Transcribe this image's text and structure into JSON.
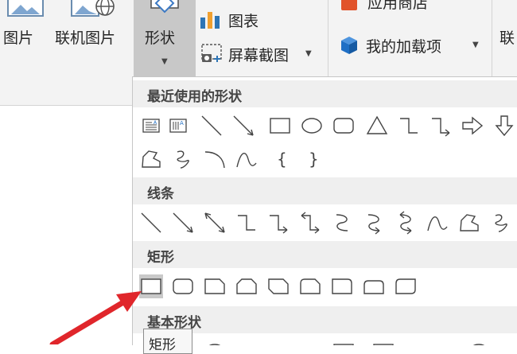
{
  "ribbon": {
    "pictures_label": "图片",
    "online_pictures_label": "联机图片",
    "shapes_label": "形状",
    "chart_label": "图表",
    "screenshot_label": "屏幕截图",
    "store_label": "应用商店",
    "my_addins_label": "我的加载项",
    "partial_label": "联",
    "chart_bar_colors": [
      "#2e75b6",
      "#f0a030",
      "#2e75b6"
    ],
    "store_icon_color": "#e1532b",
    "addins_icon_color": "#1f6fc5"
  },
  "shapes_panel": {
    "sections": [
      {
        "title": "最近使用的形状"
      },
      {
        "title": "线条"
      },
      {
        "title": "矩形"
      },
      {
        "title": "基本形状"
      }
    ],
    "recent_row1": [
      "text-box-icon",
      "vertical-text-box-icon",
      "line-icon",
      "arrow-line-icon",
      "rectangle-icon",
      "oval-icon",
      "rounded-rectangle-icon",
      "triangle-icon",
      "elbow-connector-icon",
      "elbow-arrow-connector-icon",
      "right-arrow-icon",
      "down-arrow-icon"
    ],
    "recent_row2": [
      "freeform-icon",
      "scribble-icon",
      "arc-icon",
      "curve-icon",
      "left-brace-icon",
      "right-brace-icon"
    ],
    "lines_row": [
      "line-icon",
      "arrow-line-icon",
      "double-arrow-line-icon",
      "elbow-connector-icon",
      "elbow-arrow-connector-icon",
      "elbow-double-arrow-icon",
      "curved-connector-icon",
      "curved-arrow-connector-icon",
      "curved-double-arrow-icon",
      "curve-icon",
      "freeform-icon",
      "scribble-icon"
    ],
    "rect_row": [
      "rectangle-icon",
      "rounded-rectangle-icon",
      "snip-single-corner-icon",
      "snip-same-side-icon",
      "snip-diagonal-icon",
      "snip-round-single-icon",
      "round-single-corner-icon",
      "round-same-side-icon",
      "round-diagonal-icon"
    ],
    "selected_shape": "rectangle-icon"
  },
  "tooltip": {
    "text": "矩形"
  },
  "annotation": {
    "color": "#e0262b"
  }
}
